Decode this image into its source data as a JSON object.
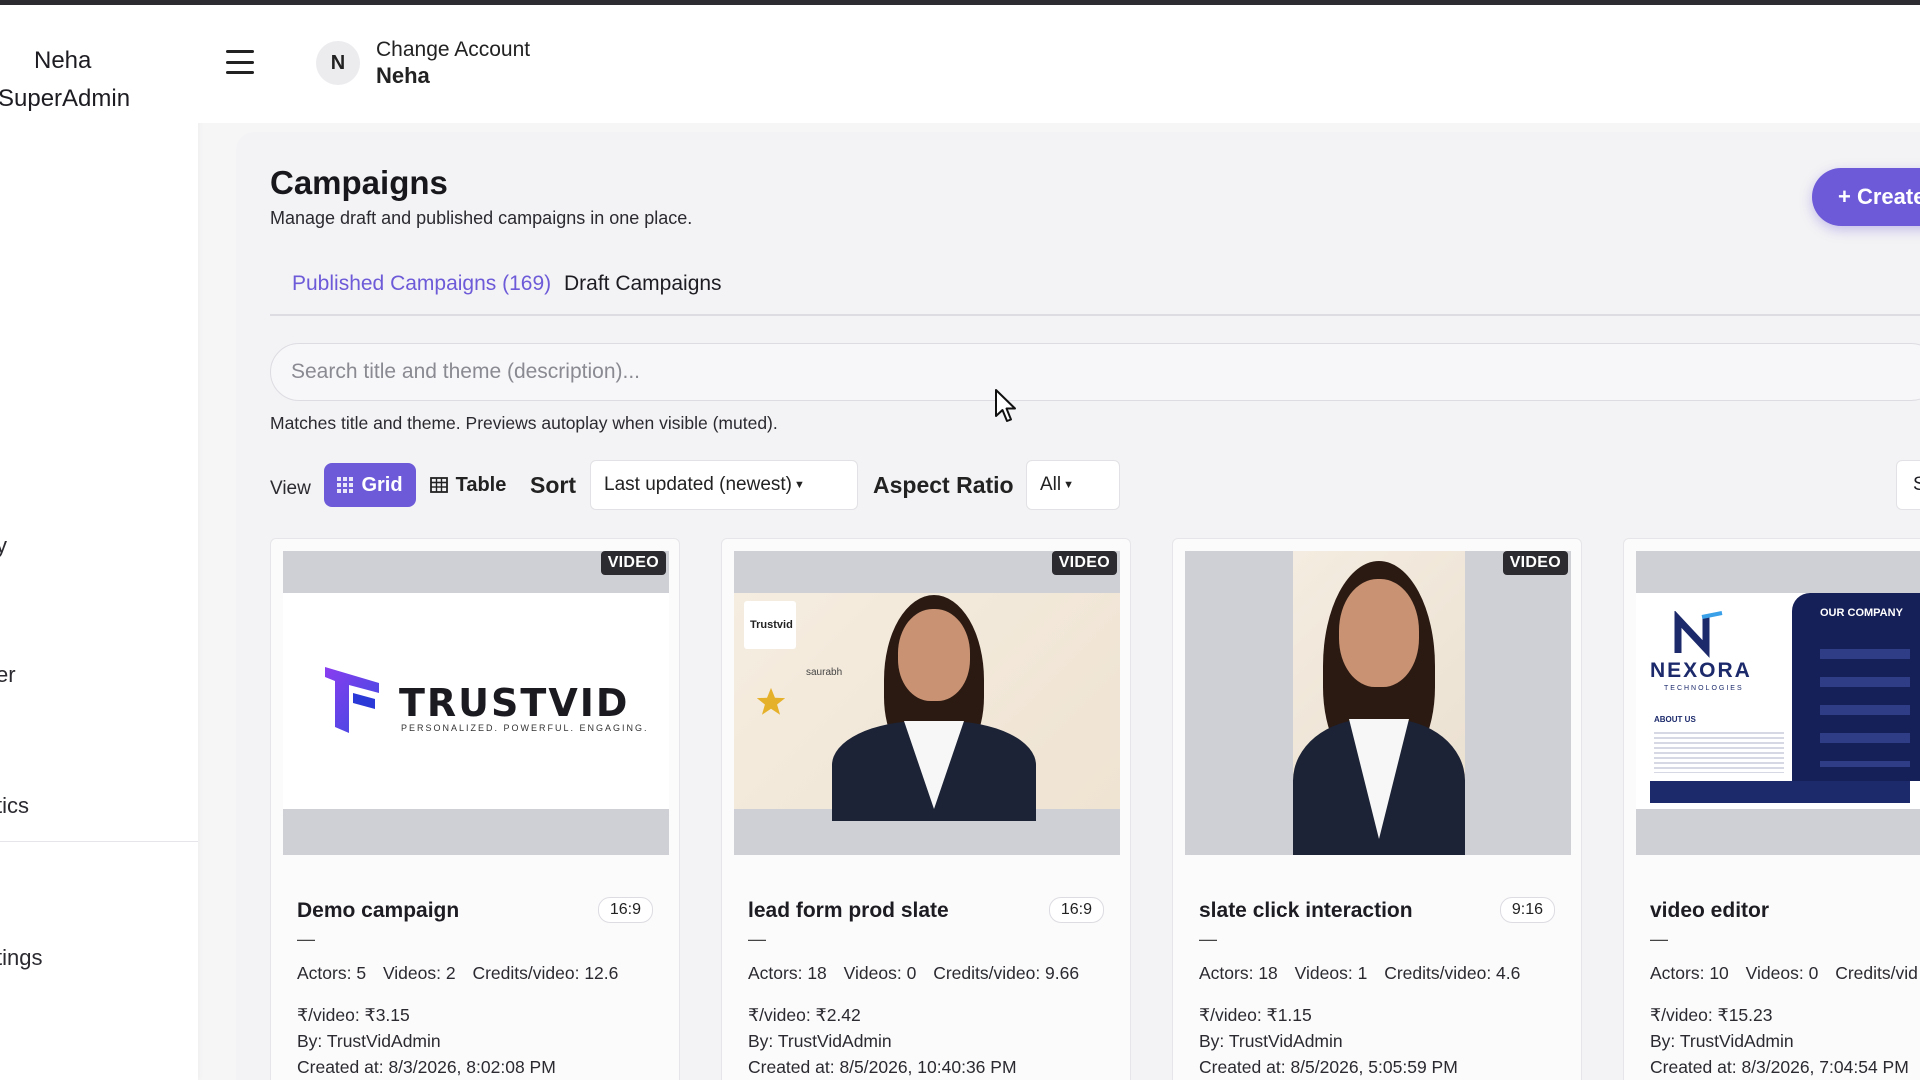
{
  "sidebar": {
    "user_name": "Neha",
    "user_role": "SuperAdmin",
    "nav_items": [
      "y",
      "er",
      "tics",
      "tings"
    ]
  },
  "header": {
    "avatar_initial": "N",
    "account_label": "Change Account",
    "account_name": "Neha"
  },
  "page": {
    "title": "Campaigns",
    "subtitle": "Manage draft and published campaigns in one place.",
    "create_button": "+ Create"
  },
  "tabs": [
    {
      "label": "Published Campaigns (169)",
      "active": true
    },
    {
      "label": "Draft Campaigns",
      "active": false
    }
  ],
  "search": {
    "placeholder": "Search title and theme (description)...",
    "hint": "Matches title and theme. Previews autoplay when visible (muted)."
  },
  "toolbar": {
    "view_label": "View",
    "grid_label": "Grid",
    "table_label": "Table",
    "sort_label": "Sort",
    "sort_value": "Last updated (newest)",
    "aspect_label": "Aspect Ratio",
    "aspect_value": "All",
    "right_select_value": "S"
  },
  "cards": [
    {
      "badge": "VIDEO",
      "title": "Demo campaign",
      "aspect": "16:9",
      "dash": "—",
      "actors": "Actors: 5",
      "videos": "Videos: 2",
      "credits": "Credits/video: 12.6",
      "price": "₹/video: ₹3.15",
      "by": "By: TrustVidAdmin",
      "created": "Created at: 8/3/2026, 8:02:08 PM",
      "thumb_logo": "TRUSTVID",
      "thumb_tagline": "PERSONALIZED. POWERFUL. ENGAGING."
    },
    {
      "badge": "VIDEO",
      "title": "lead form prod slate",
      "aspect": "16:9",
      "dash": "—",
      "actors": "Actors: 18",
      "videos": "Videos: 0",
      "credits": "Credits/video: 9.66",
      "price": "₹/video: ₹2.42",
      "by": "By: TrustVidAdmin",
      "created": "Created at: 8/5/2026, 10:40:36 PM",
      "thumb_brand": "Trustvid",
      "thumb_name": "saurabh"
    },
    {
      "badge": "VIDEO",
      "title": "slate click interaction",
      "aspect": "9:16",
      "dash": "—",
      "actors": "Actors: 18",
      "videos": "Videos: 1",
      "credits": "Credits/video: 4.6",
      "price": "₹/video: ₹1.15",
      "by": "By: TrustVidAdmin",
      "created": "Created at: 8/5/2026, 5:05:59 PM"
    },
    {
      "badge": "",
      "title": "video editor",
      "aspect": "",
      "dash": "—",
      "actors": "Actors: 10",
      "videos": "Videos: 0",
      "credits": "Credits/vid",
      "price": "₹/video: ₹15.23",
      "by": "By: TrustVidAdmin",
      "created": "Created at: 8/3/2026, 7:04:54 PM",
      "thumb_brand": "NEXORA",
      "thumb_sub": "TECHNOLOGIES",
      "thumb_panel_title": "OUR COMPANY",
      "thumb_about": "ABOUT US"
    }
  ],
  "colors": {
    "accent": "#6c5ad8",
    "badge_bg": "#2c2c30"
  }
}
